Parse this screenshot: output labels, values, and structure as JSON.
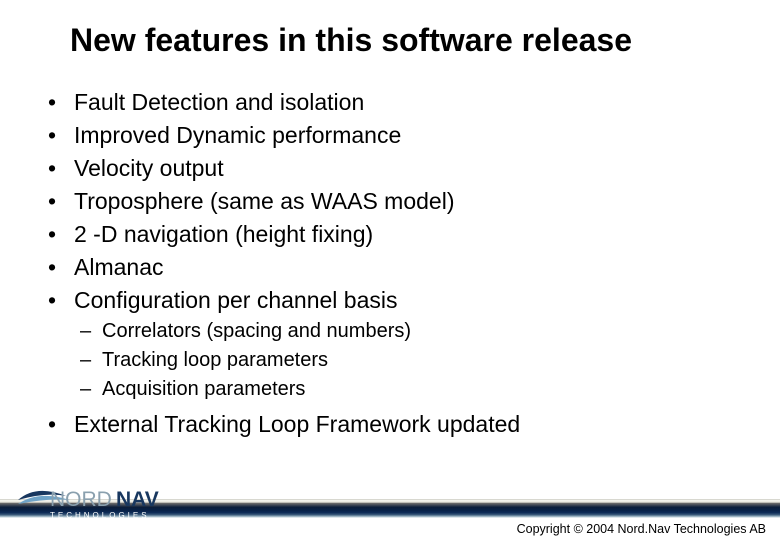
{
  "title": "New features in this software release",
  "bullets": {
    "b0": "Fault Detection and isolation",
    "b1": "Improved Dynamic performance",
    "b2": "Velocity output",
    "b3": "Troposphere (same as WAAS model)",
    "b4": "2 -D navigation (height fixing)",
    "b5": "Almanac",
    "b6": "Configuration per channel basis",
    "b7": "External Tracking Loop Framework updated"
  },
  "sub_bullets": {
    "s0": "Correlators (spacing and numbers)",
    "s1": "Tracking loop parameters",
    "s2": "Acquisition parameters"
  },
  "footer": {
    "logo_nord": "NORD",
    "logo_nav": "NAV",
    "logo_sub": "TECHNOLOGIES",
    "copyright": "Copyright © 2004 Nord.Nav Technologies AB"
  }
}
